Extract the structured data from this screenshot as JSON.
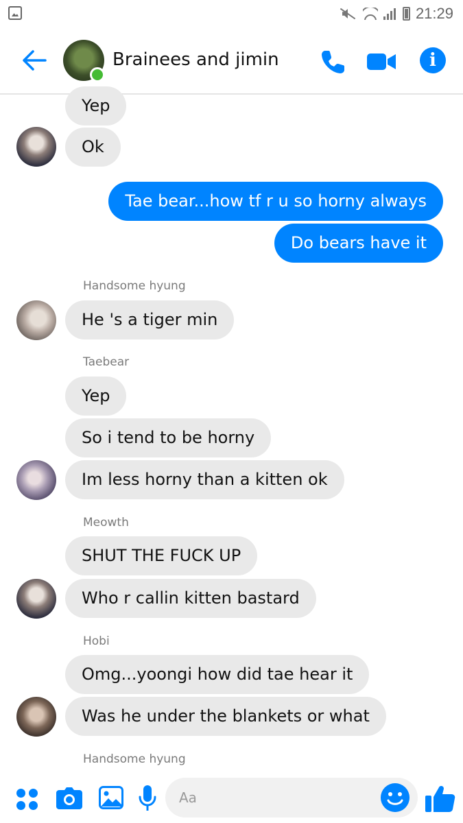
{
  "status_bar": {
    "time": "21:29",
    "icons": [
      "gallery-icon",
      "mute-icon",
      "wifi-icon",
      "signal-icon",
      "battery-icon"
    ]
  },
  "header": {
    "title": "Brainees and jimin",
    "online": true,
    "icons": [
      "back-arrow-icon",
      "phone-icon",
      "video-camera-icon",
      "info-icon"
    ]
  },
  "messages": [
    {
      "side": "in",
      "text": "Yep"
    },
    {
      "side": "in",
      "text": "Ok"
    },
    {
      "side": "out",
      "text": "Tae bear...how tf r u so horny always"
    },
    {
      "side": "out",
      "text": "Do bears have it"
    },
    {
      "sender": "Handsome hyung"
    },
    {
      "side": "in",
      "text": "He 's a tiger min"
    },
    {
      "sender": "Taebear"
    },
    {
      "side": "in",
      "text": "Yep"
    },
    {
      "side": "in",
      "text": "So i tend to be horny"
    },
    {
      "side": "in",
      "text": "Im less horny than a kitten ok"
    },
    {
      "sender": "Meowth"
    },
    {
      "side": "in",
      "text": "SHUT THE FUCK UP"
    },
    {
      "side": "in",
      "text": "Who r callin kitten bastard"
    },
    {
      "sender": "Hobi"
    },
    {
      "side": "in",
      "text": "Omg...yoongi how did tae hear it"
    },
    {
      "side": "in",
      "text": "Was he under the blankets or what"
    },
    {
      "sender": "Handsome hyung"
    }
  ],
  "composer": {
    "placeholder": "Aa",
    "icons": [
      "apps-icon",
      "camera-icon",
      "photo-icon",
      "microphone-icon",
      "emoji-icon",
      "thumbs-up-icon"
    ]
  },
  "colors": {
    "accent": "#0084ff",
    "incoming_bubble": "#e9e9e9",
    "online": "#44bb33"
  }
}
